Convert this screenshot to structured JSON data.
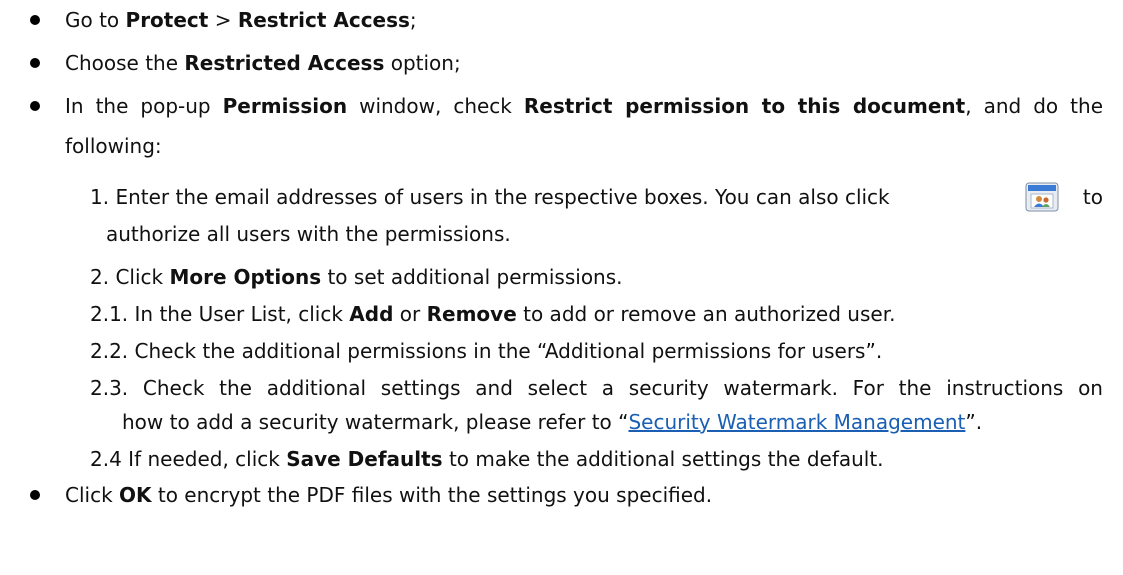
{
  "bullets": [
    {
      "pre": "Go to ",
      "b1": "Protect",
      "mid": " > ",
      "b2": "Restrict Access",
      "post": ";"
    },
    {
      "pre": "Choose the ",
      "b1": "Restricted Access",
      "post": " option;"
    },
    {
      "pre": "In the pop-up ",
      "b1": "Permission",
      "mid": " window, check ",
      "b2": "Restrict permission to this document",
      "post": ", and do the",
      "cont": "following:"
    }
  ],
  "steps": {
    "s1_a": "1. Enter the email addresses of users in the respective boxes. You can also click",
    "s1_b": "to",
    "s1_cont": "authorize all users with the permissions.",
    "s2_pre": "2. Click ",
    "s2_bold": "More Options",
    "s2_post": " to set additional permissions.",
    "s21_pre": "2.1. In the User List, click ",
    "s21_b1": "Add",
    "s21_mid": " or ",
    "s21_b2": "Remove",
    "s21_post": " to add or remove an authorized user.",
    "s22": "2.2. Check the additional permissions in the “Additional permissions for users”.",
    "s23_a": "2.3. Check the additional settings and select a security watermark. For the instructions on",
    "s23_b_pre": "how to add a security watermark, please refer to “",
    "s23_link": "Security Watermark Management",
    "s23_b_post": "”.",
    "s24_pre": "2.4 If needed, click ",
    "s24_bold": "Save Defaults",
    "s24_post": " to make the additional settings the default."
  },
  "last_bullet": {
    "pre": "Click ",
    "b1": "OK",
    "post": " to encrypt the PDF files with the settings you specified."
  },
  "icons": {
    "authorize_users_icon": "users-window-icon"
  }
}
